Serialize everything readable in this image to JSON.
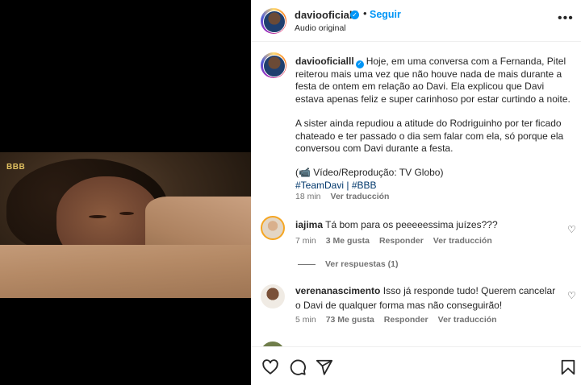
{
  "media": {
    "watermark": "BBB"
  },
  "header": {
    "username": "daviooficialll",
    "follow_label": "Seguir",
    "audio_label": "Audio original",
    "more_label": "•••"
  },
  "caption": {
    "username": "daviooficialll",
    "paragraph1": "Hoje, em uma conversa com a Fernanda, Pitel reiterou mais uma vez que não houve nada de mais durante a festa de ontem em relação ao Davi. Ela explicou que Davi estava apenas feliz e super carinhoso por estar curtindo a noite.",
    "paragraph2": "A sister ainda repudiou a atitude do Rodriguinho por ter ficado chateado e ter passado o dia sem falar com ela, só porque ela conversou com Davi durante a festa.",
    "credit": "(📹 Vídeo/Reprodução: TV Globo)",
    "hashtag1": "#TeamDavi",
    "separator": " | ",
    "hashtag2": "#BBB",
    "time": "18 min",
    "translate": "Ver traducción"
  },
  "comments": [
    {
      "username": "iajima",
      "text": "Tá bom para os peeeeessima juízes???",
      "time": "7 min",
      "likes": "3 Me gusta",
      "reply": "Responder",
      "translate": "Ver traducción",
      "view_replies": "Ver respuestas (1)"
    },
    {
      "username": "verenanascimento",
      "text": "Isso já responde tudo! Querem cancelar o Davi de qualquer forma mas não conseguirão!",
      "time": "5 min",
      "likes": "73 Me gusta",
      "reply": "Responder",
      "translate": "Ver traducción"
    }
  ],
  "footer": {
    "icons": [
      "heart-icon",
      "comment-icon",
      "share-icon",
      "bookmark-icon"
    ]
  }
}
